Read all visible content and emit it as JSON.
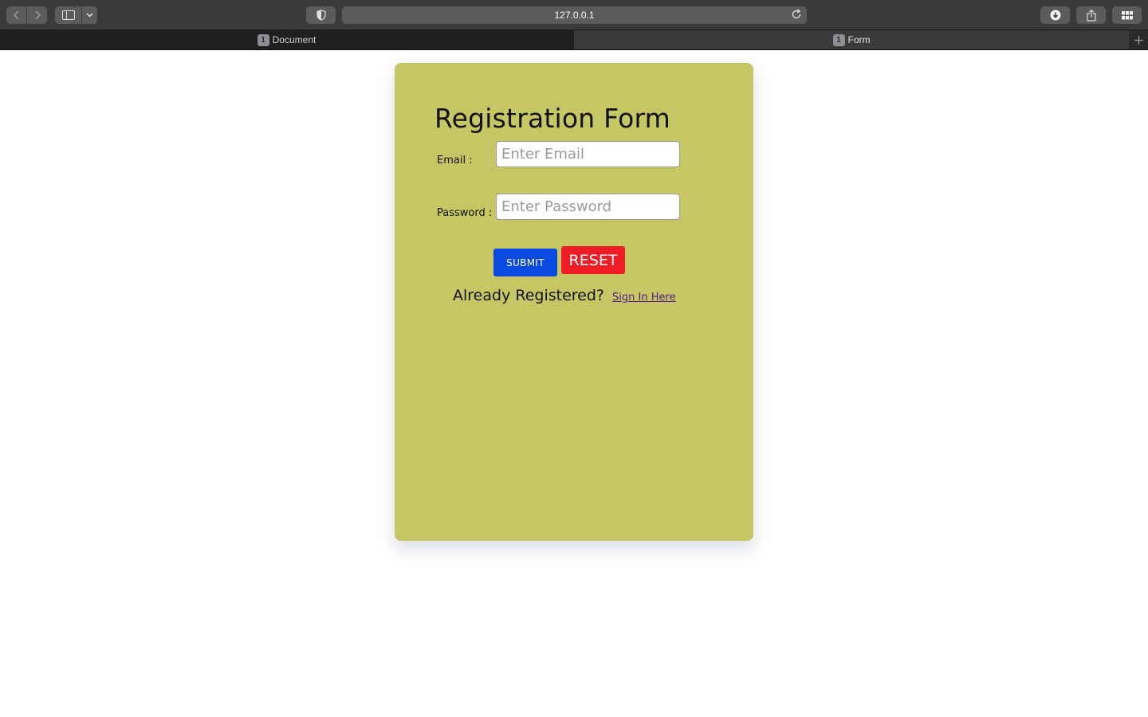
{
  "browser": {
    "address": "127.0.0.1",
    "tabs": [
      {
        "badge": "1",
        "label": "Document"
      },
      {
        "badge": "1",
        "label": "Form"
      }
    ],
    "icons": [
      "back-icon",
      "forward-icon",
      "sidebar-icon",
      "chevron-down-icon",
      "shield-icon",
      "reload-icon",
      "download-icon",
      "share-icon",
      "tabs-overview-icon",
      "plus-icon"
    ]
  },
  "form": {
    "title": "Registration Form",
    "email_label": "Email :",
    "email_placeholder": "Enter Email",
    "password_label": "Password :",
    "password_placeholder": "Enter Password",
    "submit_label": "SUBMIT",
    "reset_label": "RESET",
    "already_text": "Already Registered?",
    "signin_link": "Sign In Here"
  },
  "colors": {
    "card": "#c6c664",
    "submit": "#0a4ae0",
    "reset": "#ee1c25"
  }
}
